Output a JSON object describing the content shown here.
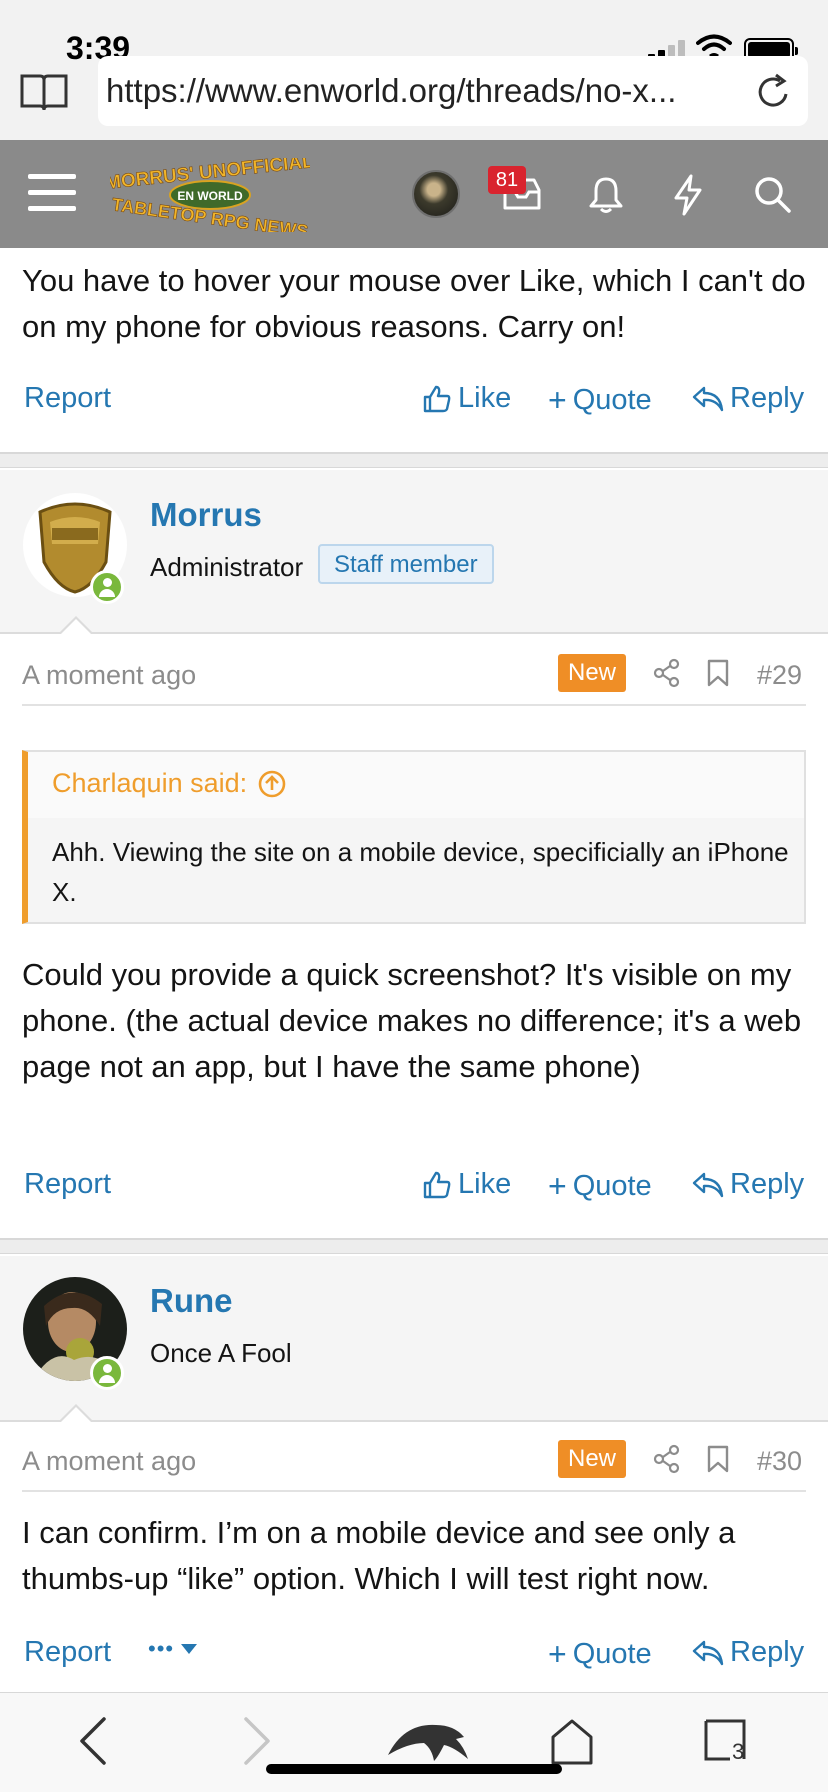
{
  "status_bar": {
    "time": "3:39"
  },
  "browser": {
    "url": "https://www.enworld.org/threads/no-x..."
  },
  "site_header": {
    "logo_line1": "MORRUS' UNOFFICIAL",
    "logo_line2": "EN WORLD",
    "logo_line3": "TABLETOP RPG NEWS",
    "inbox_count": "81"
  },
  "posts": [
    {
      "body": "You have to hover your mouse over Like, which I can't do on my phone for obvious reasons. Carry on!",
      "actions": {
        "report": "Report",
        "like": "Like",
        "quote": "Quote",
        "reply": "Reply"
      }
    },
    {
      "author": "Morrus",
      "user_title": "Administrator",
      "badge": "Staff member",
      "time": "A moment ago",
      "new_label": "New",
      "number": "#29",
      "quote": {
        "author": "Charlaquin said:",
        "text": "Ahh. Viewing the site on a mobile device, specificially an iPhone X."
      },
      "body": "Could you provide a quick screenshot? It's visible on my phone. (the actual device makes no difference; it's a web page not an app, but I have the same phone)",
      "actions": {
        "report": "Report",
        "like": "Like",
        "quote": "Quote",
        "reply": "Reply"
      }
    },
    {
      "author": "Rune",
      "user_title": "Once A Fool",
      "time": "A moment ago",
      "new_label": "New",
      "number": "#30",
      "body": "I can confirm. I’m on a mobile device and see only a thumbs-up “like” option. Which I will test right now.",
      "actions": {
        "report": "Report",
        "more": "•••",
        "quote": "Quote",
        "reply": "Reply"
      }
    }
  ],
  "toolbar": {
    "tab_count": "3"
  },
  "colors": {
    "link": "#2577b1",
    "new_badge": "#ef8e26",
    "quote_accent": "#ef9d2c",
    "online": "#7ab83c",
    "header_bg": "#8a8a8a"
  }
}
